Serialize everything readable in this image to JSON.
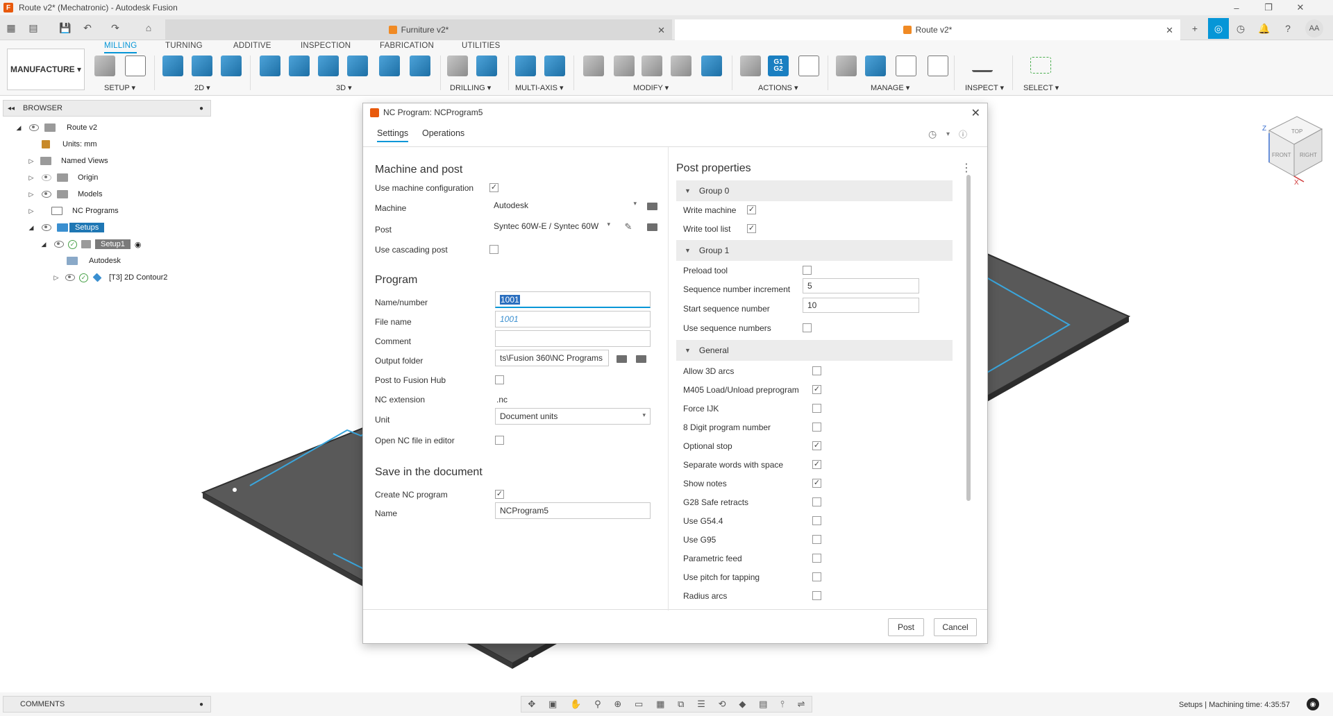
{
  "window": {
    "title": "Route v2* (Mechatronic) - Autodesk Fusion",
    "minimize": "–",
    "maximize": "❐",
    "close": "✕"
  },
  "doc_tabs": [
    {
      "label": "Furniture v2*",
      "close": "✕"
    },
    {
      "label": "Route v2*",
      "close": "✕"
    }
  ],
  "ribbon": {
    "tabs": [
      "MILLING",
      "TURNING",
      "ADDITIVE",
      "INSPECTION",
      "FABRICATION",
      "UTILITIES"
    ],
    "workspace": "MANUFACTURE ▾",
    "groups": [
      "SETUP ▾",
      "2D ▾",
      "3D ▾",
      "DRILLING ▾",
      "MULTI-AXIS ▾",
      "MODIFY ▾",
      "ACTIONS ▾",
      "MANAGE ▾",
      "INSPECT ▾",
      "SELECT ▾"
    ],
    "g1g2_label": "G1\nG2"
  },
  "browser": {
    "header": "BROWSER",
    "items": {
      "root": "Route v2",
      "units": "Units: mm",
      "named_views": "Named Views",
      "origin": "Origin",
      "models": "Models",
      "nc_programs": "NC Programs",
      "setups": "Setups",
      "setup1": "Setup1",
      "autodesk": "Autodesk",
      "contour": "[T3] 2D Contour2"
    }
  },
  "dialog": {
    "title": "NC Program: NCProgram5",
    "tabs": [
      "Settings",
      "Operations"
    ],
    "machine_post": {
      "title": "Machine and post",
      "use_machine_config_label": "Use machine configuration",
      "use_machine_config": true,
      "machine_label": "Machine",
      "machine_value": "Autodesk",
      "post_label": "Post",
      "post_value": "Syntec 60W-E / Syntec 60W",
      "cascading_label": "Use cascading post",
      "cascading": false
    },
    "program": {
      "title": "Program",
      "name_label": "Name/number",
      "name_value": "1001",
      "filename_label": "File name",
      "filename_value": "1001",
      "comment_label": "Comment",
      "comment_value": "",
      "output_label": "Output folder",
      "output_value": "ts\\Fusion 360\\NC Programs",
      "hub_label": "Post to Fusion Hub",
      "hub": false,
      "ext_label": "NC extension",
      "ext_value": ".nc",
      "unit_label": "Unit",
      "unit_value": "Document units",
      "open_editor_label": "Open NC file in editor",
      "open_editor": false
    },
    "save": {
      "title": "Save in the document",
      "create_label": "Create NC program",
      "create": true,
      "name_label": "Name",
      "name_value": "NCProgram5"
    },
    "post_properties": {
      "title": "Post properties",
      "group0": "Group 0",
      "write_machine": "Write machine",
      "write_tool_list": "Write tool list",
      "group1": "Group 1",
      "preload_tool": "Preload tool",
      "seq_increment_label": "Sequence number increment",
      "seq_increment": "5",
      "start_seq_label": "Start sequence number",
      "start_seq": "10",
      "use_seq_label": "Use sequence numbers",
      "general": "General",
      "general_items": [
        {
          "label": "Allow 3D arcs",
          "checked": false
        },
        {
          "label": "M405 Load/Unload preprogram",
          "checked": true
        },
        {
          "label": "Force IJK",
          "checked": false
        },
        {
          "label": "8 Digit program number",
          "checked": false
        },
        {
          "label": "Optional stop",
          "checked": true
        },
        {
          "label": "Separate words with space",
          "checked": true
        },
        {
          "label": "Show notes",
          "checked": true
        },
        {
          "label": "G28 Safe retracts",
          "checked": false
        },
        {
          "label": "Use G54.4",
          "checked": false
        },
        {
          "label": "Use G95",
          "checked": false
        },
        {
          "label": "Parametric feed",
          "checked": false
        },
        {
          "label": "Use pitch for tapping",
          "checked": false
        },
        {
          "label": "Radius arcs",
          "checked": false
        }
      ]
    },
    "buttons": {
      "post": "Post",
      "cancel": "Cancel"
    }
  },
  "bottom": {
    "comments": "COMMENTS",
    "status": "Setups | Machining time: 4:35:57"
  },
  "viewcube": {
    "top": "TOP",
    "front": "FRONT",
    "right": "RIGHT",
    "z": "Z",
    "x": "X"
  },
  "user_initials": "AA"
}
